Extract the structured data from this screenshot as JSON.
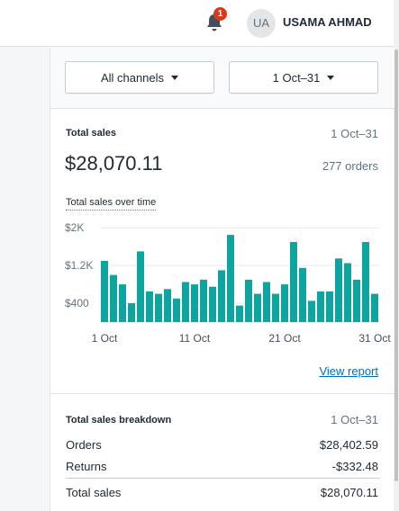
{
  "header": {
    "notification_count": "1",
    "avatar_initials": "UA",
    "user_name": "USAMA AHMAD"
  },
  "filters": {
    "channel_label": "All channels",
    "date_label": "1 Oct–31"
  },
  "total_sales_card": {
    "title": "Total sales",
    "date_range": "1 Oct–31",
    "amount": "$28,070.11",
    "orders": "277 orders",
    "chart_title": "Total sales over time",
    "view_report_label": "View report"
  },
  "chart_data": {
    "type": "bar",
    "title": "Total sales over time",
    "y_tick_labels": [
      "$2K",
      "$1.2K",
      "$400"
    ],
    "y_ticks": [
      2000,
      1200,
      400
    ],
    "x_tick_labels": [
      "1 Oct",
      "11 Oct",
      "21 Oct",
      "31 Oct"
    ],
    "x_ticks": [
      1,
      11,
      21,
      31
    ],
    "ylim": [
      0,
      2100
    ],
    "grid": true,
    "color": "#0ea5a0",
    "categories": [
      1,
      2,
      3,
      4,
      5,
      6,
      7,
      8,
      9,
      10,
      11,
      12,
      13,
      14,
      15,
      16,
      17,
      18,
      19,
      20,
      21,
      22,
      23,
      24,
      25,
      26,
      27,
      28,
      29,
      30,
      31
    ],
    "values": [
      1300,
      1000,
      800,
      400,
      1500,
      650,
      600,
      700,
      500,
      850,
      800,
      900,
      750,
      1100,
      1850,
      350,
      900,
      600,
      850,
      600,
      800,
      1700,
      1150,
      450,
      650,
      650,
      1350,
      1250,
      900,
      1700,
      600
    ]
  },
  "breakdown_card": {
    "title": "Total sales breakdown",
    "date_range": "1 Oct–31",
    "rows": [
      {
        "label": "Orders",
        "value": "$28,402.59"
      },
      {
        "label": "Returns",
        "value": "-$332.48"
      },
      {
        "label": "Total sales",
        "value": "$28,070.11"
      }
    ]
  },
  "icons": {
    "bell": "bell-icon",
    "caret": "caret-down-icon"
  }
}
